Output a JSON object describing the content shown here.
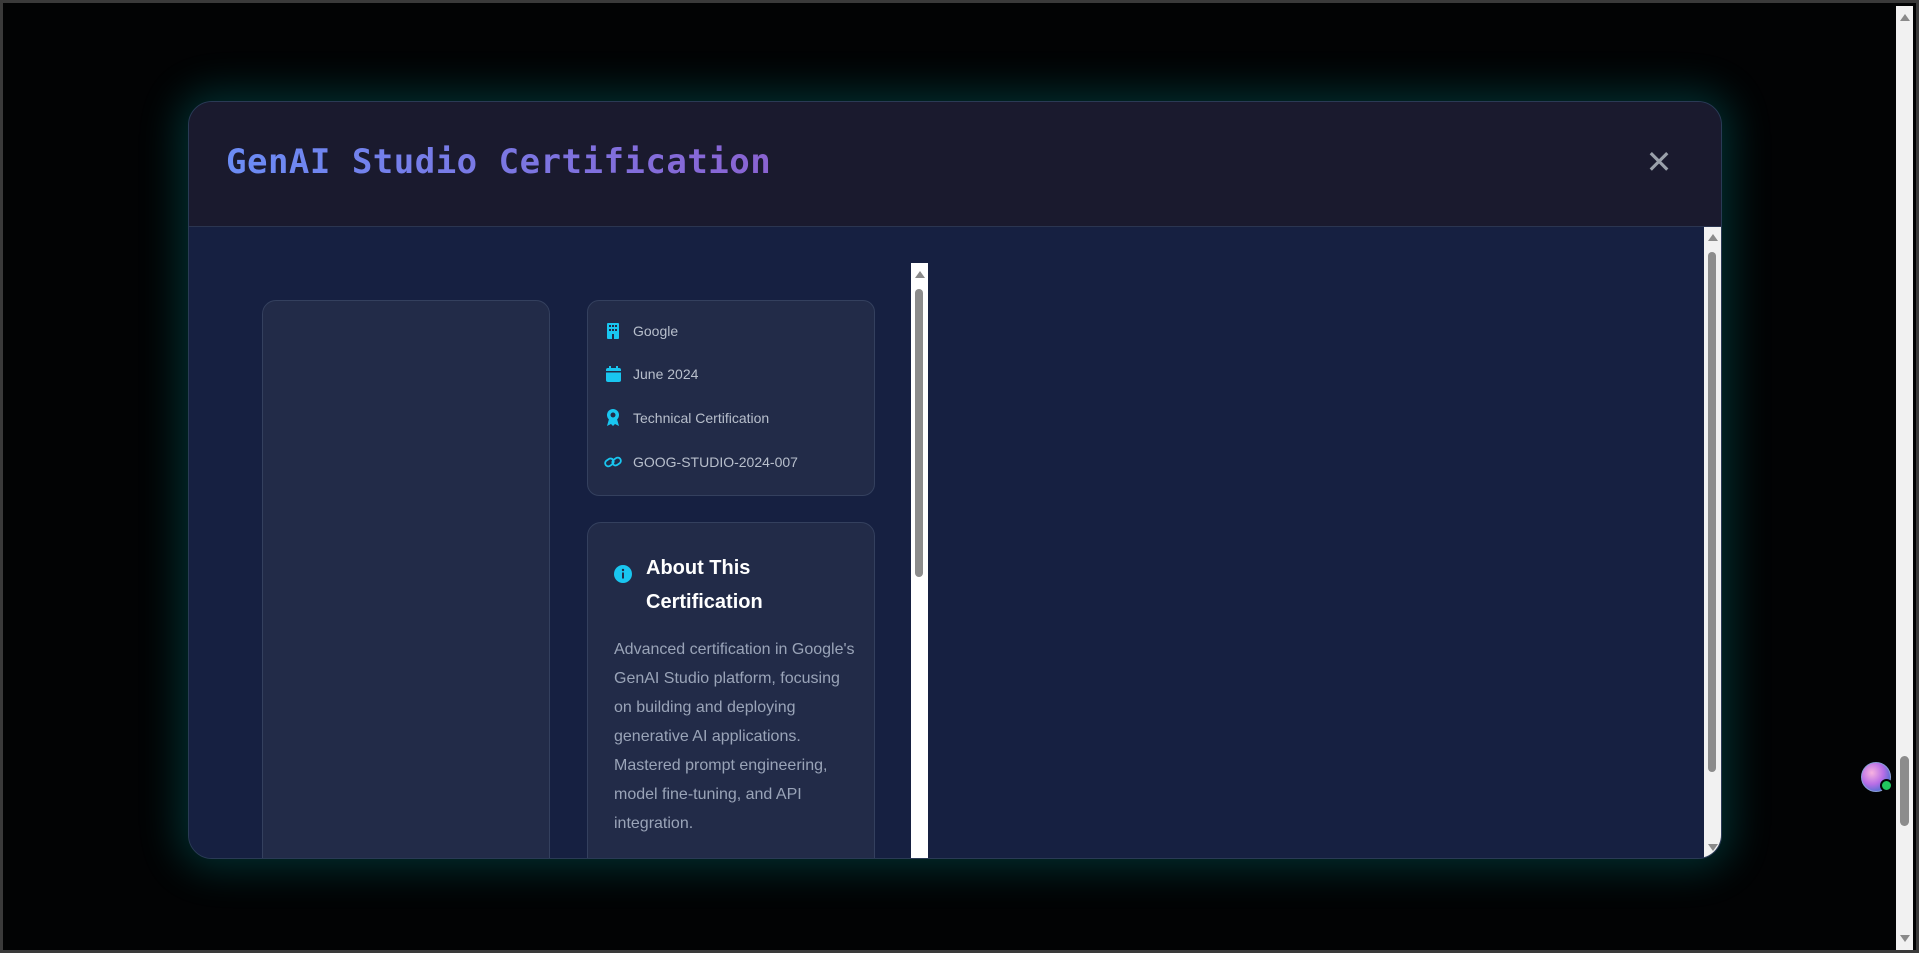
{
  "modal": {
    "title": "GenAI Studio Certification",
    "close_label": "✕"
  },
  "details": {
    "items": [
      {
        "icon": "building-icon",
        "label": "Google"
      },
      {
        "icon": "calendar-icon",
        "label": "June 2024"
      },
      {
        "icon": "award-icon",
        "label": "Technical Certification"
      },
      {
        "icon": "link-icon",
        "label": "GOOG-STUDIO-2024-007"
      }
    ]
  },
  "about": {
    "icon": "info-icon",
    "title": "About This Certification",
    "text": "Advanced certification in Google's GenAI Studio platform, focusing on building and deploying generative AI applications. Mastered prompt engineering, model fine-tuning, and API integration."
  },
  "colors": {
    "accent_cyan": "#19c6f0",
    "title_gradient_start": "#6b8cf5",
    "title_gradient_end": "#8a63d2",
    "online_status": "#22c55e"
  }
}
